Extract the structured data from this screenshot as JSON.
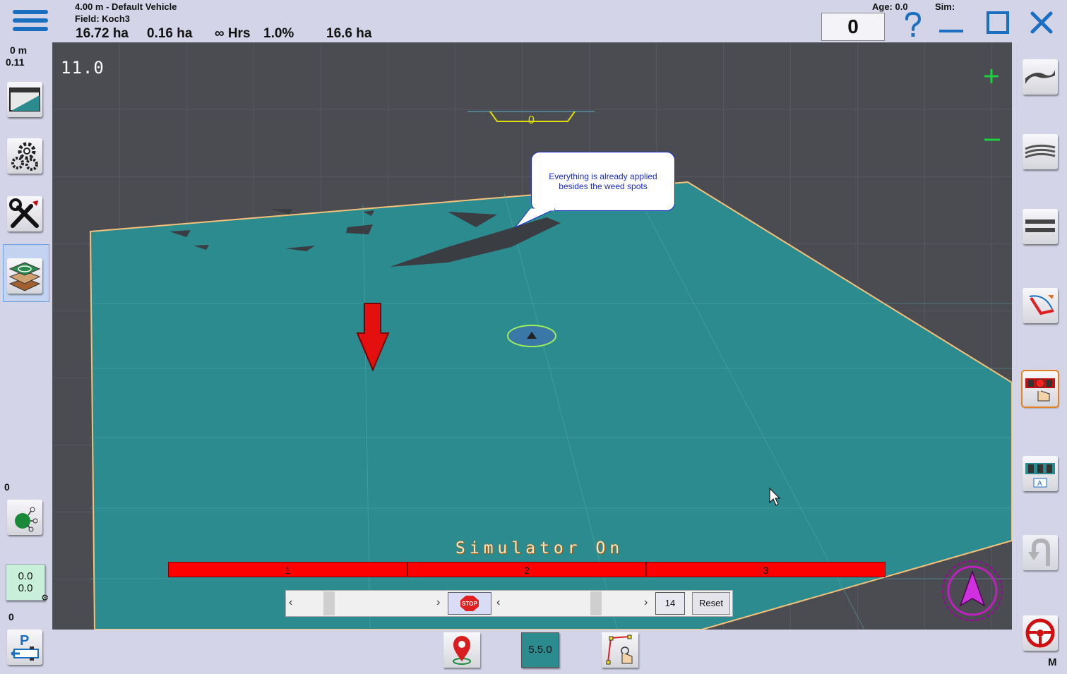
{
  "header": {
    "vehicle": "4.00 m - Default Vehicle",
    "field": "Field: Koch3",
    "area_total": "16.72 ha",
    "area_done": "0.16 ha",
    "hours": "∞ Hrs",
    "percent": "1.0%",
    "area_remaining": "16.6 ha",
    "age_label": "Age: 0.0",
    "sim_label": "Sim:",
    "counter": "0"
  },
  "left_panel": {
    "distance": "0 m",
    "offset": "0.11",
    "rtk_count": "0",
    "xy_top": "0.0",
    "xy_bottom": "0.0",
    "bottom_count": "0"
  },
  "viewport": {
    "zoom": "11.0",
    "tram_number": "0",
    "callout": "Everything is already applied besides the weed spots",
    "status": "Simulator On"
  },
  "sections": [
    "1",
    "2",
    "3"
  ],
  "sim_controls": {
    "speed_value": "14",
    "reset_label": "Reset",
    "stop_label": "STOP"
  },
  "bottom_bar": {
    "version": "5.5.0"
  },
  "right_panel": {
    "mode_label": "M"
  },
  "icons": [
    "hamburger-icon",
    "help-icon",
    "minimize-icon",
    "maximize-icon",
    "close-icon",
    "display-icon",
    "settings-icon",
    "tools-icon",
    "field-layers-icon",
    "ntrip-icon",
    "park-icon",
    "contour-icon",
    "autosteer-icon",
    "section-manual-icon",
    "section-auto-icon",
    "uturn-icon",
    "steer-wheel-icon",
    "map-pin-icon",
    "boundary-edit-icon",
    "compass-arrow-icon"
  ],
  "colors": {
    "field": "#2c8b8f",
    "section_off": "#ff0000",
    "callout_text": "#1b2bd0",
    "accent_blue": "#1a6fc0"
  }
}
